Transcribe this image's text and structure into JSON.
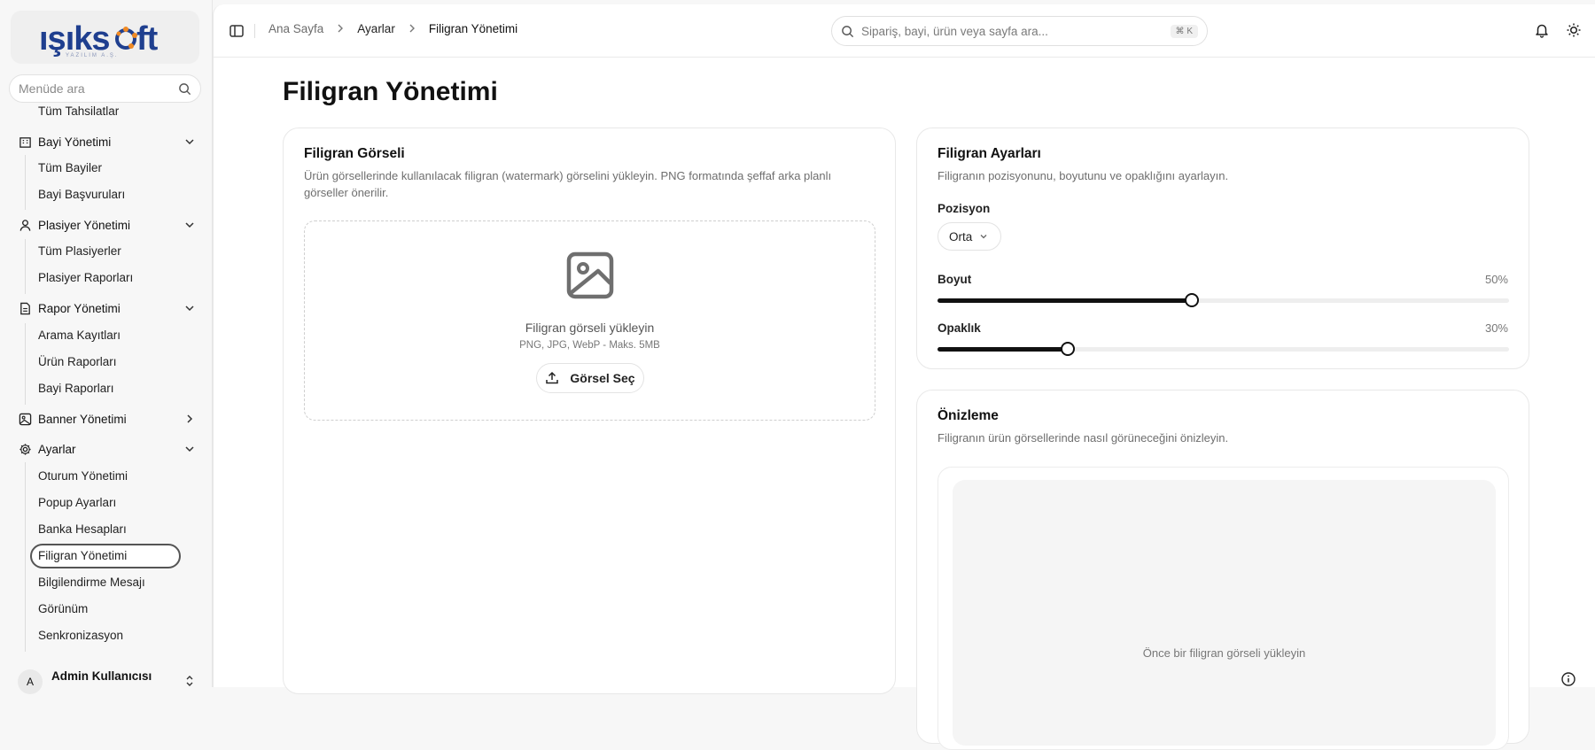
{
  "brand": {
    "logo_text": "ışıksoft",
    "logo_sub": "YAZILIM A.Ş."
  },
  "sidebar": {
    "search_placeholder": "Menüde ara",
    "items": [
      {
        "label": "Tüm Tahsilatlar"
      },
      {
        "label": "Bayi Yönetimi"
      },
      {
        "label": "Tüm Bayiler"
      },
      {
        "label": "Bayi Başvuruları"
      },
      {
        "label": "Plasiyer Yönetimi"
      },
      {
        "label": "Tüm Plasiyerler"
      },
      {
        "label": "Plasiyer Raporları"
      },
      {
        "label": "Rapor Yönetimi"
      },
      {
        "label": "Arama Kayıtları"
      },
      {
        "label": "Ürün Raporları"
      },
      {
        "label": "Bayi Raporları"
      },
      {
        "label": "Banner Yönetimi"
      },
      {
        "label": "Ayarlar"
      },
      {
        "label": "Oturum Yönetimi"
      },
      {
        "label": "Popup Ayarları"
      },
      {
        "label": "Banka Hesapları"
      },
      {
        "label": "Filigran Yönetimi"
      },
      {
        "label": "Bilgilendirme Mesajı"
      },
      {
        "label": "Görünüm"
      },
      {
        "label": "Senkronizasyon"
      }
    ],
    "user": {
      "avatar": "A",
      "name": "Admin Kullanıcısı"
    }
  },
  "topbar": {
    "breadcrumb": [
      "Ana Sayfa",
      "Ayarlar",
      "Filigran Yönetimi"
    ],
    "search_placeholder": "Sipariş, bayi, ürün veya sayfa ara...",
    "search_shortcut": "⌘ K"
  },
  "page": {
    "title": "Filigran Yönetimi"
  },
  "upload_card": {
    "title": "Filigran Görseli",
    "description": "Ürün görsellerinde kullanılacak filigran (watermark) görselini yükleyin. PNG formatında şeffaf arka planlı görseller önerilir.",
    "drop_title": "Filigran görseli yükleyin",
    "drop_hint": "PNG, JPG, WebP - Maks. 5MB",
    "button_label": "Görsel Seç"
  },
  "settings_card": {
    "title": "Filigran Ayarları",
    "description": "Filigranın pozisyonunu, boyutunu ve opaklığını ayarlayın.",
    "position_label": "Pozisyon",
    "position_value": "Orta",
    "size_label": "Boyut",
    "size_value": "50%",
    "size_fraction": 0.445,
    "opacity_label": "Opaklık",
    "opacity_value": "30%",
    "opacity_fraction": 0.228
  },
  "preview_card": {
    "title": "Önizleme",
    "description": "Filigranın ürün görsellerinde nasıl görüneceğini önizleyin.",
    "empty_text": "Önce bir filigran görseli yükleyin"
  },
  "colors": {
    "accent": "#111111",
    "brand_blue": "#1f3f8f",
    "brand_orange": "#f08a24"
  }
}
